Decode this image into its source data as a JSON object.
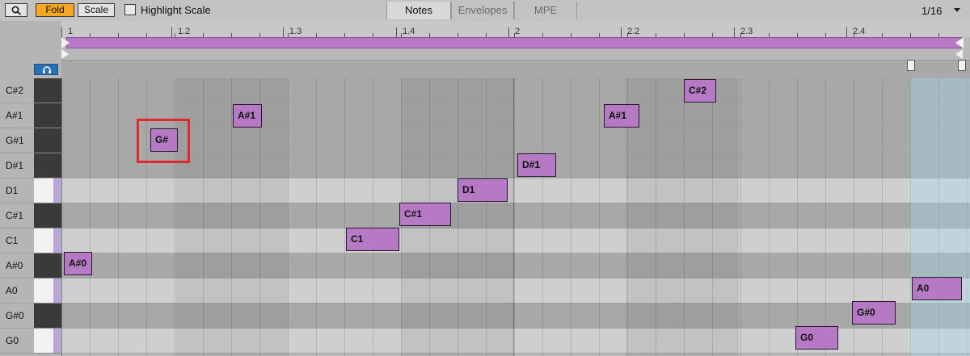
{
  "toolbar": {
    "fold_label": "Fold",
    "scale_label": "Scale",
    "highlight_scale_label": "Highlight Scale",
    "tabs": [
      "Notes",
      "Envelopes",
      "MPE"
    ],
    "grid_value": "1/16"
  },
  "ruler": {
    "labels": [
      "1",
      "1.2",
      "1.3",
      "1.4",
      "2",
      "2.2",
      "2.3",
      "2.4"
    ]
  },
  "keyboard": {
    "rows": [
      {
        "label": "C#2",
        "key": "black"
      },
      {
        "label": "A#1",
        "key": "black"
      },
      {
        "label": "G#1",
        "key": "black"
      },
      {
        "label": "D#1",
        "key": "black"
      },
      {
        "label": "D1",
        "key": "white"
      },
      {
        "label": "C#1",
        "key": "black"
      },
      {
        "label": "C1",
        "key": "white"
      },
      {
        "label": "A#0",
        "key": "black"
      },
      {
        "label": "A0",
        "key": "white"
      },
      {
        "label": "G#0",
        "key": "black"
      },
      {
        "label": "G0",
        "key": "white"
      }
    ]
  },
  "notes": [
    {
      "label": "A#0"
    },
    {
      "label": "G#"
    },
    {
      "label": "A#1"
    },
    {
      "label": "C1"
    },
    {
      "label": "C#1"
    },
    {
      "label": "D1"
    },
    {
      "label": "D#1"
    },
    {
      "label": "A#1"
    },
    {
      "label": "C#2"
    },
    {
      "label": "G0"
    },
    {
      "label": "G#0"
    },
    {
      "label": "A0"
    }
  ],
  "colors": {
    "note_fill": "#b67ac5",
    "fold_active": "#f5a623",
    "highlight_outline": "#e0282e"
  }
}
